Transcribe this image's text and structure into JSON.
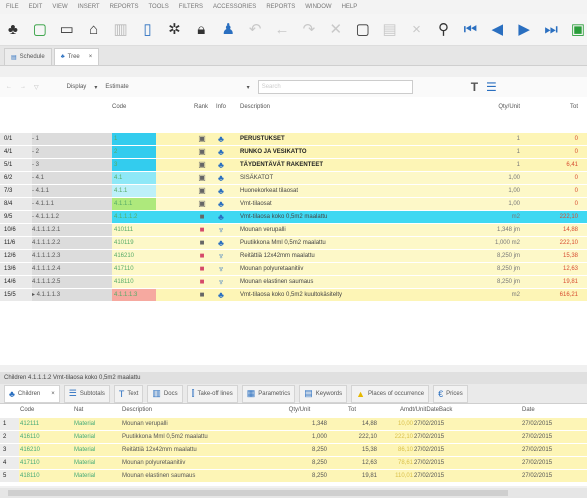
{
  "menu": [
    "FILE",
    "EDIT",
    "VIEW",
    "INSERT",
    "REPORTS",
    "TOOLS",
    "FILTERS",
    "ACCESSORIES",
    "REPORTS",
    "WINDOW",
    "HELP"
  ],
  "toolbar_icons": [
    "hierarchy-icon",
    "new-document-icon",
    "open-folder-icon",
    "home-icon",
    "chart-icon",
    "document-icon",
    "gear-icon",
    "lock-icon",
    "users-icon",
    "undo-icon",
    "back-icon",
    "forward-icon",
    "cut-icon",
    "copy-icon",
    "paste-icon",
    "close-icon",
    "search-icon",
    "first-icon",
    "previous-icon",
    "next-icon",
    "last-icon",
    "exit-icon"
  ],
  "doc_tabs": [
    {
      "label": "Schedule",
      "active": false
    },
    {
      "label": "Tree",
      "active": true
    }
  ],
  "filter": {
    "left_label": "Display",
    "right_label": "Estimate",
    "search_placeholder": "Search"
  },
  "grid": {
    "headers": {
      "code": "Code",
      "rank": "Rank",
      "info": "Info",
      "desc": "Description",
      "unit": "Qty/Unit",
      "tot": "Tot"
    },
    "rows": [
      {
        "num": "0/1",
        "tree": "- 1",
        "code": "1",
        "rank": "▣",
        "info": "♣",
        "desc": "PERUSTUKSET",
        "unit": "1",
        "total": "0",
        "bold": true,
        "bg": "#fdf5b6",
        "codebg": "#33ccee",
        "icon": "group"
      },
      {
        "num": "4/1",
        "tree": "- 2",
        "code": "2",
        "rank": "▣",
        "info": "♣",
        "desc": "RUNKO JA VESIKATTO",
        "unit": "1",
        "total": "0",
        "bold": true,
        "bg": "#fdf5b6",
        "codebg": "#33ccee",
        "icon": "group"
      },
      {
        "num": "5/1",
        "tree": "- 3",
        "code": "3",
        "rank": "▣",
        "info": "♣",
        "desc": "TÄYDENTÄVÄT RAKENTEET",
        "unit": "1",
        "total": "6,41",
        "bold": true,
        "bg": "#fdf5b6",
        "codebg": "#33ccee",
        "icon": "group"
      },
      {
        "num": "6/2",
        "tree": "- 4.1",
        "code": "4.1",
        "rank": "▣",
        "info": "♣",
        "desc": "SISÄKATOT",
        "unit": "1,00",
        "total": "0",
        "bold": false,
        "bg": "#fdf8c8",
        "codebg": "#8ee8f7",
        "icon": "group"
      },
      {
        "num": "7/3",
        "tree": "- 4.1.1",
        "code": "4.1.1",
        "rank": "▣",
        "info": "♣",
        "desc": "Huonekorkeat tilaosat",
        "unit": "1,00",
        "total": "0",
        "bold": false,
        "bg": "#fdf8c8",
        "codebg": "#bdf0f9",
        "icon": "group"
      },
      {
        "num": "8/4",
        "tree": "- 4.1.1.1",
        "code": "4.1.1.1",
        "rank": "▣",
        "info": "♣",
        "desc": "Vmt-tilaosat",
        "unit": "1,00",
        "total": "0",
        "bold": false,
        "bg": "#fdf8c8",
        "codebg": "#aee97c",
        "icon": "group"
      },
      {
        "num": "9/5",
        "tree": "- 4.1.1.1.2",
        "code": "4.1.1.1.2",
        "rank": "■",
        "info": "♣",
        "desc": "Vmt-tilaosa koko 0,5m2 maalattu",
        "unit": "m2",
        "total": "222,10",
        "bold": false,
        "bg": "#3fd8f2",
        "codebg": "#3fd8f2",
        "icon": "group"
      },
      {
        "num": "10/6",
        "tree": "4.1.1.1.2.1",
        "code": "410111",
        "rank": "■",
        "info": "♆",
        "desc": "Mounan verupalli",
        "unit": "1,348 jm",
        "total": "14,88",
        "bold": false,
        "bg": "#fdf8c8",
        "codebg": "#fdf8c8",
        "icon": "material"
      },
      {
        "num": "11/6",
        "tree": "4.1.1.1.2.2",
        "code": "410119",
        "rank": "■",
        "info": "♣",
        "desc": "Puutikkona Mml 0,5m2 maalattu",
        "unit": "1,000 m2",
        "total": "222,10",
        "bold": false,
        "bg": "#fdf8c8",
        "codebg": "#fdf8c8",
        "icon": "group"
      },
      {
        "num": "12/6",
        "tree": "4.1.1.1.2.3",
        "code": "416210",
        "rank": "■",
        "info": "♆",
        "desc": "Reitättiä 12x42mm maalattu",
        "unit": "8,250 jm",
        "total": "15,38",
        "bold": false,
        "bg": "#fdf8c8",
        "codebg": "#fdf8c8",
        "icon": "material"
      },
      {
        "num": "13/6",
        "tree": "4.1.1.1.2.4",
        "code": "417110",
        "rank": "■",
        "info": "♆",
        "desc": "Mounan polyuretaanitiiv",
        "unit": "8,250 jm",
        "total": "12,63",
        "bold": false,
        "bg": "#fdf8c8",
        "codebg": "#fdf8c8",
        "icon": "material"
      },
      {
        "num": "14/6",
        "tree": "4.1.1.1.2.5",
        "code": "418110",
        "rank": "■",
        "info": "♆",
        "desc": "Mounan elastinen saumaus",
        "unit": "8,250 jm",
        "total": "19,81",
        "bold": false,
        "bg": "#fdf8c8",
        "codebg": "#fdf8c8",
        "icon": "material"
      },
      {
        "num": "15/5",
        "tree": "▸ 4.1.1.1.3",
        "code": "4.1.1.1.3",
        "rank": "■",
        "info": "♣",
        "desc": "Vmt-tilaosa koko 0,5m2 kuultokäsitelty",
        "unit": "m2",
        "total": "616,21",
        "bold": false,
        "bg": "#fdf5b6",
        "codebg": "#f6a9a0",
        "icon": "group"
      }
    ]
  },
  "status_text": "Children 4.1.1.1.2 Vmt-tilaosa koko 0,5m2 maalattu",
  "panel_tabs": [
    {
      "label": "Children",
      "active": true,
      "icon": "hierarchy-icon"
    },
    {
      "label": "Subtotals",
      "active": false,
      "icon": "lines-icon"
    },
    {
      "label": "Text",
      "active": false,
      "icon": "text-icon"
    },
    {
      "label": "Docs",
      "active": false,
      "icon": "docs-icon"
    },
    {
      "label": "Take-off lines",
      "active": false,
      "icon": "takeoff-icon"
    },
    {
      "label": "Parametrics",
      "active": false,
      "icon": "parametrics-icon"
    },
    {
      "label": "Keywords",
      "active": false,
      "icon": "keywords-icon"
    },
    {
      "label": "Places of occurrence",
      "active": false,
      "icon": "warning-icon"
    },
    {
      "label": "Prices",
      "active": false,
      "icon": "prices-icon"
    }
  ],
  "panel": {
    "headers": {
      "code": "Code",
      "nat": "Nat",
      "desc": "Description",
      "qty": "Qty/Unit",
      "tot": "Tot",
      "date": "Amdt/UnitDateBack",
      "date2": "Date"
    },
    "rows": [
      {
        "num": "1",
        "code": "412111",
        "nat": "Material",
        "desc": "Mounan verupalli",
        "qty": "1,348",
        "tot": "14,88",
        "price": "10,00",
        "date1": "27/02/2015",
        "date2": "27/02/2015"
      },
      {
        "num": "2",
        "code": "416110",
        "nat": "Material",
        "desc": "Puutikkona Mml 0,5m2 maalattu",
        "qty": "1,000",
        "tot": "222,10",
        "price": "222,10",
        "date1": "27/02/2015",
        "date2": "27/02/2015"
      },
      {
        "num": "3",
        "code": "416210",
        "nat": "Material",
        "desc": "Reitättiä 12x42mm maalattu",
        "qty": "8,250",
        "tot": "15,38",
        "price": "86,10",
        "date1": "27/02/2015",
        "date2": "27/02/2015"
      },
      {
        "num": "4",
        "code": "417110",
        "nat": "Material",
        "desc": "Mounan polyuretaanitiiv",
        "qty": "8,250",
        "tot": "12,63",
        "price": "78,61",
        "date1": "27/02/2015",
        "date2": "27/02/2015"
      },
      {
        "num": "5",
        "code": "418110",
        "nat": "Material",
        "desc": "Mounan elastinen saumaus",
        "qty": "8,250",
        "tot": "19,81",
        "price": "110,01",
        "date1": "27/02/2015",
        "date2": "27/02/2015"
      }
    ]
  }
}
